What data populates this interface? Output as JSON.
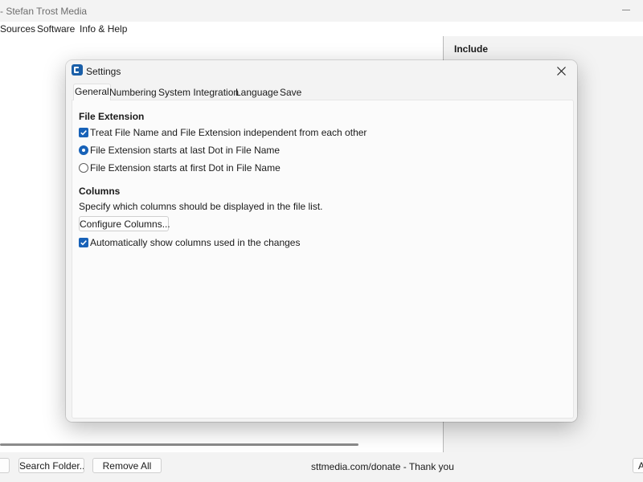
{
  "window": {
    "title": "- Stefan Trost Media"
  },
  "menu": {
    "items": [
      {
        "label": "Sources"
      },
      {
        "label": "Software"
      },
      {
        "label": "Info & Help"
      }
    ]
  },
  "right_pane": {
    "include_label": "Include"
  },
  "bottom": {
    "search_folder_label": "Search Folder...",
    "remove_all_label": "Remove All",
    "donate_text": "sttmedia.com/donate - Thank you",
    "right_button_label": "A"
  },
  "dialog": {
    "title": "Settings",
    "tabs": [
      {
        "label": "General",
        "active": true
      },
      {
        "label": "Numbering",
        "active": false
      },
      {
        "label": "System Integration",
        "active": false
      },
      {
        "label": "Language",
        "active": false
      },
      {
        "label": "Save",
        "active": false
      }
    ],
    "file_extension": {
      "heading": "File Extension",
      "independent_checkbox": {
        "label": "Treat File Name and File Extension independent from each other",
        "checked": true
      },
      "radio_last_dot": {
        "label": "File Extension starts at last Dot in File Name",
        "selected": true
      },
      "radio_first_dot": {
        "label": "File Extension starts at first Dot in File Name",
        "selected": false
      }
    },
    "columns": {
      "heading": "Columns",
      "description": "Specify which columns should be displayed in the file list.",
      "configure_button_label": "Configure Columns...",
      "auto_show_checkbox": {
        "label": "Automatically show columns used in the changes",
        "checked": true
      }
    }
  },
  "colors": {
    "accent": "#1862b8",
    "window_bg": "#f3f3f3",
    "panel_bg": "#fbfbfb"
  },
  "icons": {
    "app": "settings-app-icon",
    "close": "close-icon",
    "check": "check-icon"
  }
}
